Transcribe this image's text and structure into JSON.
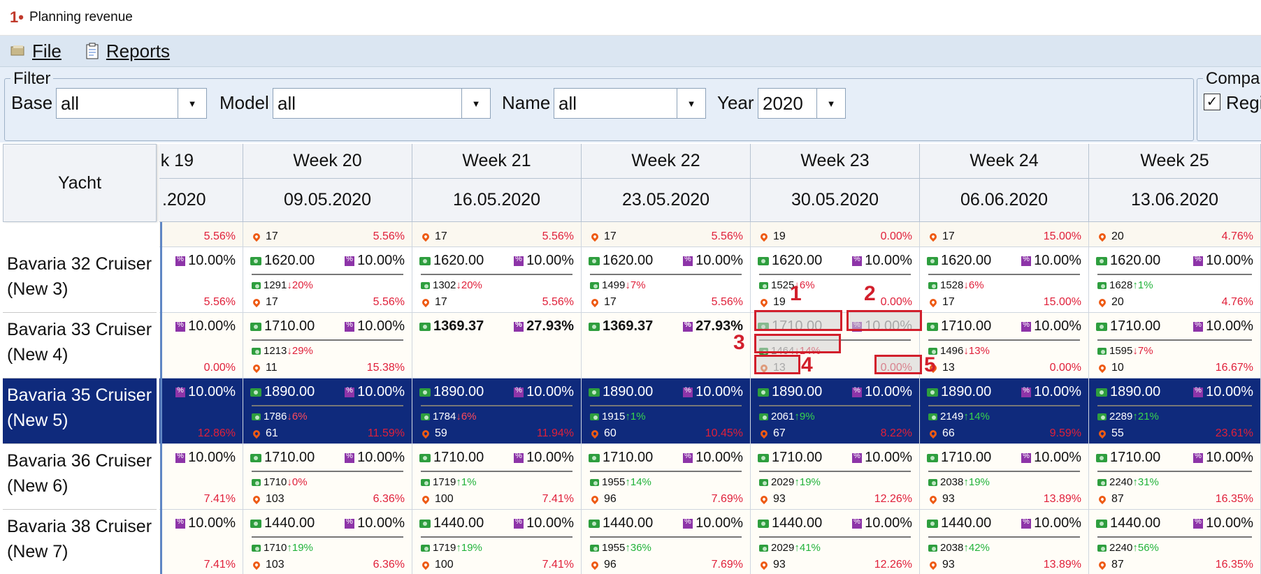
{
  "window": {
    "title": "Planning revenue",
    "logo": "1•"
  },
  "menu": {
    "file": "File",
    "reports": "Reports"
  },
  "filter": {
    "legend": "Filter",
    "base_label": "Base",
    "base_value": "all",
    "model_label": "Model",
    "model_value": "all",
    "name_label": "Name",
    "name_value": "all",
    "year_label": "Year",
    "year_value": "2020"
  },
  "compare": {
    "legend": "Compar",
    "check_label": "Regi",
    "checked": "✓"
  },
  "grid": {
    "yacht_header": "Yacht",
    "weeks": [
      {
        "week": "k 19",
        "date": ".2020"
      },
      {
        "week": "Week 20",
        "date": "09.05.2020"
      },
      {
        "week": "Week 21",
        "date": "16.05.2020"
      },
      {
        "week": "Week 22",
        "date": "23.05.2020"
      },
      {
        "week": "Week 23",
        "date": "30.05.2020"
      },
      {
        "week": "Week 24",
        "date": "06.06.2020"
      },
      {
        "week": "Week 25",
        "date": "13.06.2020"
      }
    ],
    "top_row": [
      {
        "pos": "",
        "pct": "5.56%"
      },
      {
        "pos": "17",
        "pct": "5.56%"
      },
      {
        "pos": "17",
        "pct": "5.56%"
      },
      {
        "pos": "17",
        "pct": "5.56%"
      },
      {
        "pos": "19",
        "pct": "0.00%"
      },
      {
        "pos": "17",
        "pct": "15.00%"
      },
      {
        "pos": "20",
        "pct": "4.76%"
      }
    ],
    "rows": [
      {
        "yacht_line1": "Bavaria 32 Cruiser",
        "yacht_line2": "(New 3)",
        "cells": [
          {
            "price": "",
            "disc": "10.00%",
            "cmp": "",
            "pos": "",
            "pct": "5.56%"
          },
          {
            "price": "1620.00",
            "disc": "10.00%",
            "cmp_val": "1291",
            "cmp_dir": "↓",
            "cmp_pct": "20%",
            "pos": "17",
            "pct": "5.56%"
          },
          {
            "price": "1620.00",
            "disc": "10.00%",
            "cmp_val": "1302",
            "cmp_dir": "↓",
            "cmp_pct": "20%",
            "pos": "17",
            "pct": "5.56%"
          },
          {
            "price": "1620.00",
            "disc": "10.00%",
            "cmp_val": "1499",
            "cmp_dir": "↓",
            "cmp_pct": "7%",
            "pos": "17",
            "pct": "5.56%"
          },
          {
            "price": "1620.00",
            "disc": "10.00%",
            "cmp_val": "1525",
            "cmp_dir": "↓",
            "cmp_pct": "6%",
            "pos": "19",
            "pct": "0.00%"
          },
          {
            "price": "1620.00",
            "disc": "10.00%",
            "cmp_val": "1528",
            "cmp_dir": "↓",
            "cmp_pct": "6%",
            "pos": "17",
            "pct": "15.00%"
          },
          {
            "price": "1620.00",
            "disc": "10.00%",
            "cmp_val": "1628",
            "cmp_dir": "↑",
            "cmp_pct": "1%",
            "pos": "20",
            "pct": "4.76%"
          }
        ]
      },
      {
        "yacht_line1": "Bavaria 33 Cruiser",
        "yacht_line2": "(New 4)",
        "cells": [
          {
            "price": "",
            "disc": "10.00%",
            "pos": "",
            "pct": "0.00%"
          },
          {
            "price": "1710.00",
            "disc": "10.00%",
            "cmp_val": "1213",
            "cmp_dir": "↓",
            "cmp_pct": "29%",
            "pos": "11",
            "pct": "15.38%"
          },
          {
            "price": "1369.37",
            "disc": "27.93%",
            "special": "magenta"
          },
          {
            "price": "1369.37",
            "disc": "27.93%",
            "special": "magenta"
          },
          {
            "price": "1710.00",
            "disc": "10.00%",
            "cmp_val": "1464",
            "cmp_dir": "↓",
            "cmp_pct": "14%",
            "pos": "13",
            "pct": "0.00%",
            "special": "grey"
          },
          {
            "price": "1710.00",
            "disc": "10.00%",
            "cmp_val": "1496",
            "cmp_dir": "↓",
            "cmp_pct": "13%",
            "pos": "13",
            "pct": "0.00%"
          },
          {
            "price": "1710.00",
            "disc": "10.00%",
            "cmp_val": "1595",
            "cmp_dir": "↓",
            "cmp_pct": "7%",
            "pos": "10",
            "pct": "16.67%"
          }
        ]
      },
      {
        "yacht_line1": "Bavaria 35 Cruiser",
        "yacht_line2": "(New 5)",
        "selected": "yes",
        "cells": [
          {
            "price": "",
            "disc": "10.00%",
            "pos": "",
            "pct": "12.86%"
          },
          {
            "price": "1890.00",
            "disc": "10.00%",
            "cmp_val": "1786",
            "cmp_dir": "↓",
            "cmp_pct": "6%",
            "pos": "61",
            "pct": "11.59%"
          },
          {
            "price": "1890.00",
            "disc": "10.00%",
            "cmp_val": "1784",
            "cmp_dir": "↓",
            "cmp_pct": "6%",
            "pos": "59",
            "pct": "11.94%"
          },
          {
            "price": "1890.00",
            "disc": "10.00%",
            "cmp_val": "1915",
            "cmp_dir": "↑",
            "cmp_pct": "1%",
            "pos": "60",
            "pct": "10.45%"
          },
          {
            "price": "1890.00",
            "disc": "10.00%",
            "cmp_val": "2061",
            "cmp_dir": "↑",
            "cmp_pct": "9%",
            "pos": "67",
            "pct": "8.22%"
          },
          {
            "price": "1890.00",
            "disc": "10.00%",
            "cmp_val": "2149",
            "cmp_dir": "↑",
            "cmp_pct": "14%",
            "pos": "66",
            "pct": "9.59%"
          },
          {
            "price": "1890.00",
            "disc": "10.00%",
            "cmp_val": "2289",
            "cmp_dir": "↑",
            "cmp_pct": "21%",
            "pos": "55",
            "pct": "23.61%"
          }
        ]
      },
      {
        "yacht_line1": "Bavaria 36 Cruiser",
        "yacht_line2": "(New 6)",
        "cells": [
          {
            "price": "",
            "disc": "10.00%",
            "pos": "",
            "pct": "7.41%"
          },
          {
            "price": "1710.00",
            "disc": "10.00%",
            "cmp_val": "1710",
            "cmp_dir": "↓",
            "cmp_pct": "0%",
            "pos": "103",
            "pct": "6.36%"
          },
          {
            "price": "1710.00",
            "disc": "10.00%",
            "cmp_val": "1719",
            "cmp_dir": "↑",
            "cmp_pct": "1%",
            "pos": "100",
            "pct": "7.41%"
          },
          {
            "price": "1710.00",
            "disc": "10.00%",
            "cmp_val": "1955",
            "cmp_dir": "↑",
            "cmp_pct": "14%",
            "pos": "96",
            "pct": "7.69%"
          },
          {
            "price": "1710.00",
            "disc": "10.00%",
            "cmp_val": "2029",
            "cmp_dir": "↑",
            "cmp_pct": "19%",
            "pos": "93",
            "pct": "12.26%"
          },
          {
            "price": "1710.00",
            "disc": "10.00%",
            "cmp_val": "2038",
            "cmp_dir": "↑",
            "cmp_pct": "19%",
            "pos": "93",
            "pct": "13.89%"
          },
          {
            "price": "1710.00",
            "disc": "10.00%",
            "cmp_val": "2240",
            "cmp_dir": "↑",
            "cmp_pct": "31%",
            "pos": "87",
            "pct": "16.35%"
          }
        ]
      },
      {
        "yacht_line1": "Bavaria 38 Cruiser",
        "yacht_line2": "(New 7)",
        "cells": [
          {
            "price": "",
            "disc": "10.00%",
            "pos": "",
            "pct": "7.41%"
          },
          {
            "price": "1440.00",
            "disc": "10.00%",
            "cmp_val": "1710",
            "cmp_dir": "↑",
            "cmp_pct": "19%",
            "pos": "103",
            "pct": "6.36%"
          },
          {
            "price": "1440.00",
            "disc": "10.00%",
            "cmp_val": "1719",
            "cmp_dir": "↑",
            "cmp_pct": "19%",
            "pos": "100",
            "pct": "7.41%"
          },
          {
            "price": "1440.00",
            "disc": "10.00%",
            "cmp_val": "1955",
            "cmp_dir": "↑",
            "cmp_pct": "36%",
            "pos": "96",
            "pct": "7.69%"
          },
          {
            "price": "1440.00",
            "disc": "10.00%",
            "cmp_val": "2029",
            "cmp_dir": "↑",
            "cmp_pct": "41%",
            "pos": "93",
            "pct": "12.26%"
          },
          {
            "price": "1440.00",
            "disc": "10.00%",
            "cmp_val": "2038",
            "cmp_dir": "↑",
            "cmp_pct": "42%",
            "pos": "93",
            "pct": "13.89%"
          },
          {
            "price": "1440.00",
            "disc": "10.00%",
            "cmp_val": "2240",
            "cmp_dir": "↑",
            "cmp_pct": "56%",
            "pos": "87",
            "pct": "16.35%"
          }
        ]
      }
    ]
  },
  "annotations": [
    "1",
    "2",
    "3",
    "4",
    "5"
  ],
  "colors": {
    "selected_row": "#0f2a7c",
    "magenta_cell": "#d62ef0",
    "highlight": "#d21f2c",
    "up": "#22b33b",
    "down": "#e0203a"
  },
  "icons": [
    "cash-icon",
    "discount-badge-icon",
    "location-pin-icon",
    "file-menu-icon",
    "reports-menu-icon"
  ]
}
